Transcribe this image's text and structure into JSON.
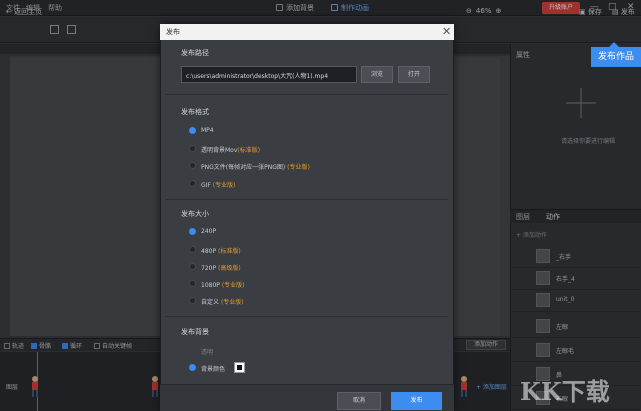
{
  "menu": [
    "文件",
    "编辑",
    "帮助"
  ],
  "topbar": {
    "add_bg": "添加背景",
    "make_anim": "制作动画",
    "upgrade": "升级账户",
    "win_controls": [
      "—",
      "□",
      "✕"
    ]
  },
  "toolbar": {
    "back_home": "返回主页",
    "zoom": "46%",
    "save": "保存",
    "publish": "发布"
  },
  "tooltip": "发布作品",
  "right_panel": {
    "title": "属性",
    "hint": "请选择你要进行编辑",
    "tabs": [
      "图层",
      "动作"
    ],
    "add_action": "+ 添加动作"
  },
  "layers": [
    {
      "name": "_右手"
    },
    {
      "name": "右手_4"
    },
    {
      "name": "unit_0"
    },
    {
      "name": "左眼"
    },
    {
      "name": "左眼毛"
    },
    {
      "name": "鼻"
    },
    {
      "name": "右眼"
    }
  ],
  "timeline": {
    "items": [
      {
        "label": "轨迹",
        "on": false
      },
      {
        "label": "骨骼",
        "on": true
      },
      {
        "label": "循环",
        "on": true
      },
      {
        "label": "自动关键帧",
        "on": false
      }
    ],
    "add_key": "添加动作",
    "layer_label": "图层",
    "add_layer": "+ 添加图层"
  },
  "dialog": {
    "title": "发布",
    "path_title": "发布路径",
    "path_value": "c:\\users\\administrator\\desktop\\大咒(人物1).mp4",
    "browse": "浏览",
    "open": "打开",
    "format_title": "发布格式",
    "formats": [
      {
        "label": "MP4",
        "tag": "",
        "on": true
      },
      {
        "label": "透明背景Mov",
        "tag": "(标准版)",
        "on": false
      },
      {
        "label": "PNG文件(每帧对应一张PNG图)",
        "tag": "(专业版)",
        "on": false
      },
      {
        "label": "GIF",
        "tag": "(专业版)",
        "on": false
      }
    ],
    "size_title": "发布大小",
    "sizes": [
      {
        "label": "240P",
        "tag": "",
        "on": true
      },
      {
        "label": "480P",
        "tag": "(标准版)",
        "on": false
      },
      {
        "label": "720P",
        "tag": "(高级版)",
        "on": false
      },
      {
        "label": "1080P",
        "tag": "(专业版)",
        "on": false
      },
      {
        "label": "自定义",
        "tag": "(专业版)",
        "on": false
      }
    ],
    "bg_title": "发布背景",
    "bg_options": [
      {
        "label": "透明",
        "tag": "",
        "on": false
      },
      {
        "label": "背景颜色",
        "tag": "",
        "on": true
      }
    ],
    "cancel": "取消",
    "publish": "发布"
  },
  "watermark": "KK下载",
  "colors": {
    "accent": "#3d8cf0",
    "tag": "#e39a2d",
    "upgrade": "#d9403b"
  }
}
